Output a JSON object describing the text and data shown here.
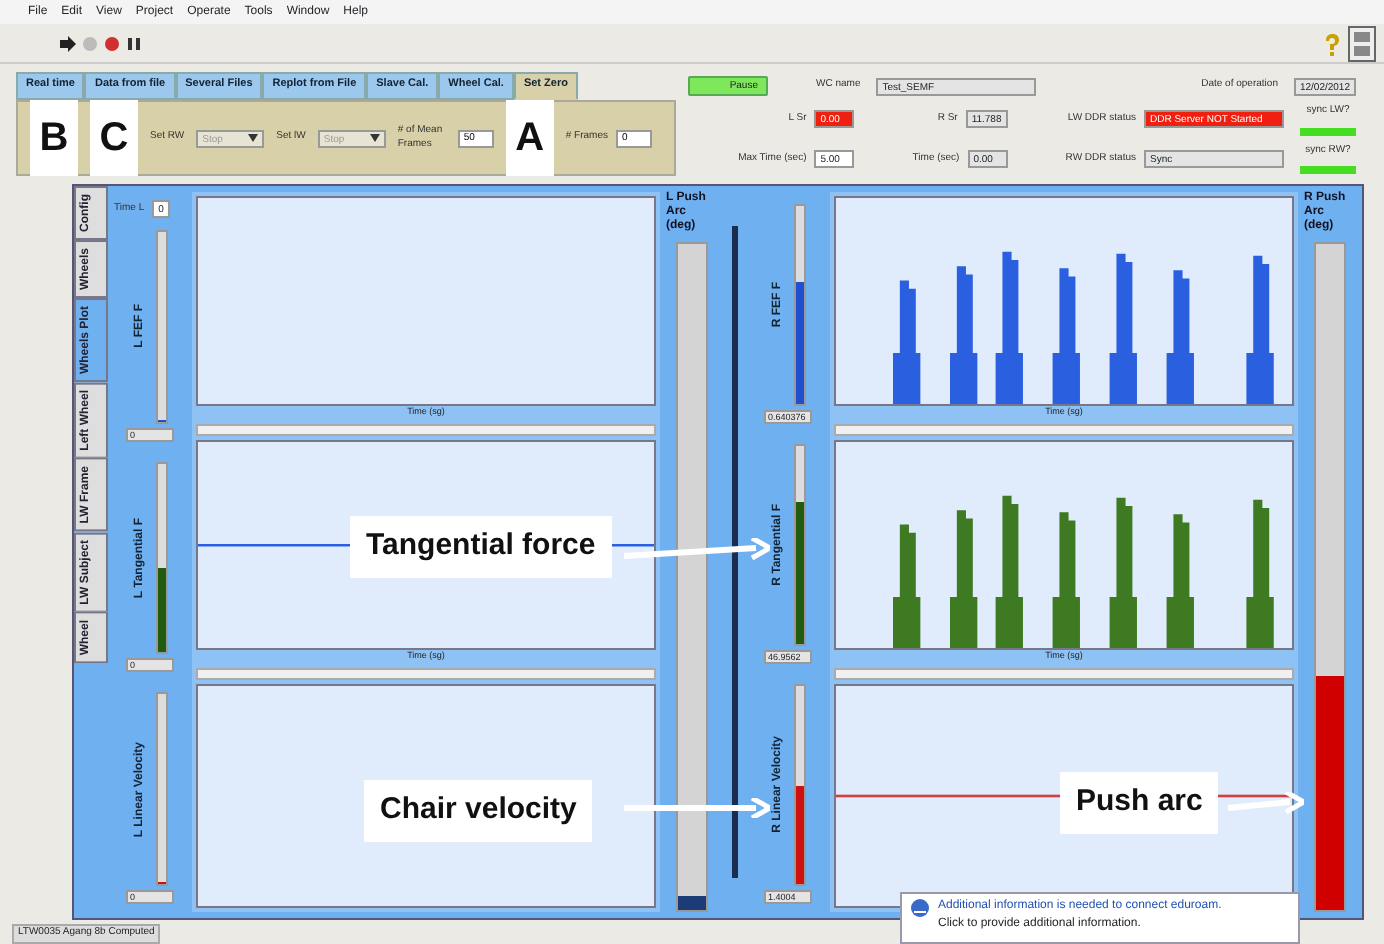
{
  "menu": [
    "File",
    "Edit",
    "View",
    "Project",
    "Operate",
    "Tools",
    "Window",
    "Help"
  ],
  "tabs": [
    {
      "label": "Real time",
      "selected": false
    },
    {
      "label": "Data from file",
      "selected": false
    },
    {
      "label": "Several Files",
      "selected": false
    },
    {
      "label": "Replot from File",
      "selected": false
    },
    {
      "label": "Slave Cal.",
      "selected": false
    },
    {
      "label": "Wheel Cal.",
      "selected": false
    },
    {
      "label": "Set Zero",
      "selected": true
    }
  ],
  "panel": [
    {
      "kind": "marker",
      "text": "B"
    },
    {
      "kind": "marker",
      "text": "C"
    },
    {
      "kind": "select",
      "label": "Set RW",
      "value": "Stop"
    },
    {
      "kind": "select",
      "label": "Set lW",
      "value": "Stop"
    },
    {
      "kind": "field",
      "label": "# of Mean Frames",
      "value": "50"
    },
    {
      "kind": "marker",
      "text": "A"
    },
    {
      "kind": "field",
      "label": "# Frames",
      "value": "0"
    }
  ],
  "status": {
    "pause_button": {
      "label": "Pause"
    },
    "wc_name": {
      "label": "WC name",
      "value": "Test_SEMF"
    },
    "date": {
      "label": "Date of operation",
      "value": "12/02/2012"
    },
    "fields": [
      {
        "label": "L Sr",
        "value": "0.00",
        "alarm": true,
        "editable": false
      },
      {
        "label": "R Sr",
        "value": "11.788",
        "alarm": false,
        "editable": false
      },
      {
        "label": "LW DDR status",
        "value": "DDR Server NOT Started",
        "alarm": true,
        "editable": false
      },
      {
        "label": "Max Time (sec)",
        "value": "5.00",
        "alarm": false,
        "editable": true
      },
      {
        "label": "Time (sec)",
        "value": "0.00",
        "alarm": false,
        "editable": false
      },
      {
        "label": "RW DDR status",
        "value": "Sync",
        "alarm": false,
        "editable": false
      }
    ],
    "sync": [
      {
        "label": "sync LW?",
        "on": true
      },
      {
        "label": "sync RW?",
        "on": true
      }
    ]
  },
  "side_tabs": [
    {
      "label": "Config",
      "selected": false
    },
    {
      "label": "Wheels",
      "selected": false
    },
    {
      "label": "Wheels Plot",
      "selected": true
    },
    {
      "label": "Left Wheel",
      "selected": false
    },
    {
      "label": "LW Frame",
      "selected": false
    },
    {
      "label": "LW Subject",
      "selected": false
    },
    {
      "label": "Wheel",
      "selected": false
    }
  ],
  "time_field": {
    "label": "Time L",
    "value": "0"
  },
  "sides": [
    {
      "gauges": [
        {
          "label": "L FEF F",
          "level": 0,
          "color": "#1f4fd0",
          "readout": "0"
        },
        {
          "label": "L Tangential F",
          "level": 0.45,
          "color": "#1f5c10",
          "readout": "0"
        },
        {
          "label": "L Linear Velocity",
          "level": 0,
          "color": "#d01010",
          "readout": "0"
        }
      ],
      "charts": [
        {
          "kind": "empty",
          "xlabel": "Time (sg)"
        },
        {
          "kind": "flatline",
          "color": "#2a5fe0",
          "xlabel": "Time (sg)"
        },
        {
          "kind": "empty"
        }
      ],
      "arc": {
        "label": "L Push Arc (deg)",
        "level": 0.02,
        "color": "#1c3c78"
      }
    },
    {
      "gauges": [
        {
          "label": "R FEF F",
          "level": 0.62,
          "color": "#1f4fd0",
          "readout": "0.640376"
        },
        {
          "label": "R Tangential F",
          "level": 0.72,
          "color": "#1f5c10",
          "readout": "46.9562"
        },
        {
          "label": "R Linear Velocity",
          "level": 0.5,
          "color": "#d01010",
          "readout": "1.4004"
        }
      ],
      "charts": [
        {
          "kind": "pulses",
          "color": "#2a5fe0",
          "xlabel": "Time (sg)"
        },
        {
          "kind": "pulses",
          "color": "#3e7a22",
          "xlabel": "Time (sg)"
        },
        {
          "kind": "flatline",
          "color": "#d04040"
        }
      ],
      "arc": {
        "label": "R Push Arc (deg)",
        "level": 0.35,
        "color": "#d00000"
      }
    }
  ],
  "annotations": [
    "Tangential force",
    "Chair velocity",
    "Push arc"
  ],
  "notification": {
    "title": "Additional information is needed to connect eduroam.",
    "detail": "Click to provide additional information."
  },
  "status_bar": "LTW0035 Agang 8b Computed"
}
